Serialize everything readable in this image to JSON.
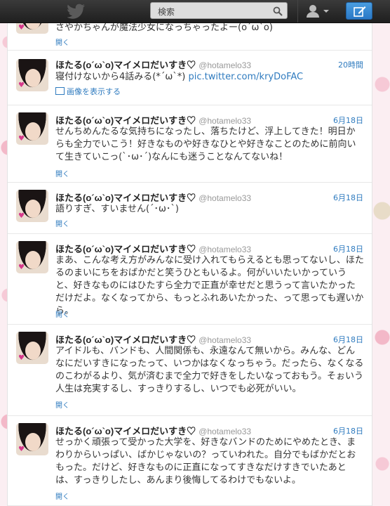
{
  "topbar": {
    "search_placeholder": "検索"
  },
  "tweets": [
    {
      "name": "",
      "handle": "",
      "time": "",
      "text": "さやかちゃんが魔法少女になっちゃったよー(o´ω`o)",
      "open": "開く"
    },
    {
      "name": "ほたる(o´ω`o)マイメロだいすき♡",
      "handle": "@hotamelo33",
      "time": "20時間",
      "text": "寝付けないから4話みる(*´ω`*)",
      "link": "pic.twitter.com/kryDoFAC",
      "media_label": "画像を表示する"
    },
    {
      "name": "ほたる(o´ω`o)マイメロだいすき♡",
      "handle": "@hotamelo33",
      "time": "6月18日",
      "text": "せんちめんたるな気持ちになったし、落ちたけど、浮上してきた！明日からも全力でいこう！好きなものや好きなひとや好きなことのために前向いて生きていこっ(`･ω･´)なんにも迷うことなんてないね！",
      "open": "開く"
    },
    {
      "name": "ほたる(o´ω`o)マイメロだいすき♡",
      "handle": "@hotamelo33",
      "time": "6月18日",
      "text": "語りすぎ、すいません(´･ω･`)",
      "open": "開く"
    },
    {
      "name": "ほたる(o´ω`o)マイメロだいすき♡",
      "handle": "@hotamelo33",
      "time": "6月18日",
      "text": "まあ、こんな考え方がみんなに受け入れてもらえるとも思ってないし、ほたるのまいにちをおばかだと笑うひともいるよ。何がいいたいかっていうと、好きなものにはひたすら全力で正直が幸せだと思うって言いたかっただけだよ。なくなってから、もっとふれあいたかった、って思っても遅いから。",
      "open": "開く"
    },
    {
      "name": "ほたる(o´ω`o)マイメロだいすき♡",
      "handle": "@hotamelo33",
      "time": "6月18日",
      "text": "アイドルも、バンドも、人間関係も、永遠なんて無いから。みんな、どんなにだいすきになったって、いつかはなくなっちゃう。だったら、なくなるのこわがるより、気が済むまで全力で好きをしたいなっておもう。そぉいう人生は充実するし、すっきりするし、いつでも必死がいい。",
      "open": "開く"
    },
    {
      "name": "ほたる(o´ω`o)マイメロだいすき♡",
      "handle": "@hotamelo33",
      "time": "6月18日",
      "text": "せっかく頑張って受かった大学を、好きなバンドのためにやめたとき、まわりからいっぱい、ばかじゃないの？っていわれた。自分でもばかだとおもった。だけど、好きなものに正直になってすきなだけすきでいたあとは、すっきりしたし、あんまり後悔してるわけでもないよ。",
      "open": "開く"
    }
  ]
}
